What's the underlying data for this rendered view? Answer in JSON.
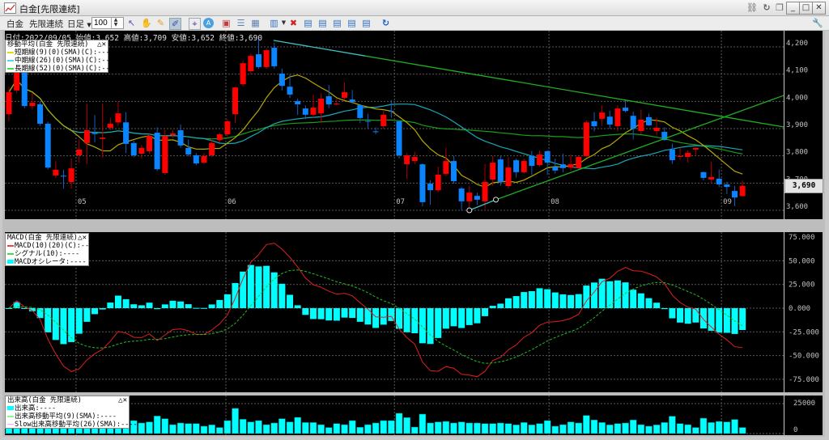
{
  "window": {
    "title": "白金[先限連続]",
    "controls": [
      "link-icon",
      "refresh-icon",
      "copy-icon",
      "minimize-icon",
      "maximize-icon",
      "close-icon"
    ]
  },
  "toolbar": {
    "symbol": "白金",
    "contract": "先限連続",
    "period": "日足",
    "count": "100",
    "tools": [
      "cursor-icon",
      "hand-icon",
      "pencil-icon",
      "trendline-icon",
      "crosshair-icon",
      "auto-icon",
      "chart-settings-icon",
      "grid-h-icon",
      "grid-icon",
      "bar-chart-icon",
      "delete-icon",
      "layout1-icon",
      "layout2-icon",
      "layout3-icon",
      "layout4-icon",
      "layout5-icon",
      "reload-icon"
    ],
    "settings_icon": "wrench-icon"
  },
  "info": "日付:2022/09/05 始値:3,652 高値:3,709 安値:3,652 終値:3,690",
  "main_legend": {
    "title": "移動平均(白金 先限連続)",
    "items": [
      {
        "label": "短期線(9)(0)(SMA)(C):----",
        "color": "#e0e000"
      },
      {
        "label": "中期線(26)(0)(SMA)(C):----",
        "color": "#40e0f0"
      },
      {
        "label": "長期線(52)(0)(SMA)(C):----",
        "color": "#40e040"
      }
    ]
  },
  "macd_legend": {
    "title": "MACD(白金 先限連続)",
    "items": [
      {
        "label": "MACD(10)(20)(C):----",
        "color": "#ff4040"
      },
      {
        "label": "シグナル(10):----",
        "color": "#40e040"
      },
      {
        "label": "MACDオシレータ:----",
        "color": "#00ffff"
      }
    ]
  },
  "volume_legend": {
    "title": "出来高(白金 先限連続)",
    "items": [
      {
        "label": "出来高:----",
        "color": "#00ffff"
      },
      {
        "label": "出来高移動平均(9)(SMA):----",
        "color": "#80ff80"
      },
      {
        "label": "Slow出来高移動平均(26)(SMA):----",
        "color": "#ffa0ff"
      }
    ]
  },
  "current_price": "3,690",
  "colors": {
    "up": "#ff0000",
    "down": "#0a84ff",
    "sma_short": "#b8a800",
    "sma_mid": "#1aa8b8",
    "sma_long": "#18a018",
    "macd": "#e02020",
    "signal": "#20c020",
    "histogram": "#00ffff",
    "volume": "#00ffff"
  },
  "chart_data": [
    {
      "type": "candlestick",
      "price_axis": {
        "ticks": [
          "4,200",
          "4,100",
          "4,000",
          "3,900",
          "3,800",
          "3,700",
          "3,600"
        ],
        "range": [
          3600,
          4200
        ]
      },
      "month_labels": [
        {
          "label": "05",
          "index": 8.6
        },
        {
          "label": "06",
          "index": 27.8
        },
        {
          "label": "07",
          "index": 49.4
        },
        {
          "label": "08",
          "index": 69.2
        },
        {
          "label": "09",
          "index": 91.3
        }
      ],
      "ohlc": [
        [
          3953,
          4053,
          3927,
          4034
        ],
        [
          4040,
          4140,
          4030,
          4125
        ],
        [
          4120,
          4130,
          3975,
          3983
        ],
        [
          3983,
          4030,
          3970,
          3995
        ],
        [
          3989,
          4000,
          3910,
          3918
        ],
        [
          3918,
          3925,
          3750,
          3757
        ],
        [
          3728,
          3781,
          3719,
          3749
        ],
        [
          3727,
          3749,
          3680,
          3724
        ],
        [
          3704,
          3790,
          3680,
          3754
        ],
        [
          3802,
          3860,
          3775,
          3823
        ],
        [
          3847,
          3990,
          3770,
          3894
        ],
        [
          3884,
          3950,
          3850,
          3880
        ],
        [
          3862,
          3992,
          3793,
          3867
        ],
        [
          3903,
          3940,
          3895,
          3918
        ],
        [
          3923,
          4000,
          3910,
          3956
        ],
        [
          3923,
          3960,
          3810,
          3844
        ],
        [
          3847,
          3855,
          3795,
          3802
        ],
        [
          3808,
          3840,
          3790,
          3829
        ],
        [
          3817,
          3880,
          3808,
          3873
        ],
        [
          3885,
          3905,
          3745,
          3751
        ],
        [
          3737,
          3895,
          3730,
          3873
        ],
        [
          3876,
          3895,
          3865,
          3882
        ],
        [
          3894,
          3915,
          3830,
          3838
        ],
        [
          3829,
          3860,
          3798,
          3805
        ],
        [
          3802,
          3810,
          3765,
          3772
        ],
        [
          3775,
          3810,
          3770,
          3799
        ],
        [
          3802,
          3865,
          3795,
          3847
        ],
        [
          3858,
          3885,
          3850,
          3879
        ],
        [
          3879,
          3935,
          3870,
          3927
        ],
        [
          3953,
          4055,
          3920,
          4051
        ],
        [
          4063,
          4150,
          4055,
          4140
        ],
        [
          4111,
          4175,
          4100,
          4167
        ],
        [
          4173,
          4232,
          4120,
          4126
        ],
        [
          4126,
          4195,
          4120,
          4188
        ],
        [
          4197,
          4215,
          4120,
          4129
        ],
        [
          4102,
          4120,
          4040,
          4057
        ],
        [
          4054,
          4100,
          4012,
          4025
        ],
        [
          4001,
          4010,
          3950,
          3989
        ],
        [
          3974,
          3985,
          3935,
          3951
        ],
        [
          3951,
          4025,
          3940,
          3977
        ],
        [
          3956,
          4030,
          3920,
          4010
        ],
        [
          4019,
          4060,
          3975,
          3989
        ],
        [
          3989,
          4010,
          3985,
          3992
        ],
        [
          4013,
          4070,
          4005,
          4034
        ],
        [
          4007,
          4042,
          3990,
          3998
        ],
        [
          3986,
          3990,
          3920,
          3939
        ],
        [
          3928,
          3955,
          3900,
          3925
        ],
        [
          3890,
          3905,
          3880,
          3887
        ],
        [
          3909,
          3965,
          3900,
          3951
        ],
        [
          3965,
          4005,
          3940,
          3962
        ],
        [
          3927,
          3930,
          3790,
          3802
        ],
        [
          3769,
          3810,
          3715,
          3802
        ],
        [
          3781,
          3815,
          3770,
          3796
        ],
        [
          3769,
          3772,
          3615,
          3630
        ],
        [
          3698,
          3710,
          3620,
          3674
        ],
        [
          3674,
          3760,
          3665,
          3731
        ],
        [
          3734,
          3830,
          3725,
          3781
        ],
        [
          3781,
          3800,
          3698,
          3707
        ],
        [
          3680,
          3685,
          3600,
          3633
        ],
        [
          3633,
          3690,
          3610,
          3665
        ],
        [
          3653,
          3665,
          3620,
          3639
        ],
        [
          3633,
          3770,
          3605,
          3704
        ],
        [
          3713,
          3800,
          3690,
          3775
        ],
        [
          3787,
          3800,
          3690,
          3704
        ],
        [
          3689,
          3795,
          3680,
          3757
        ],
        [
          3784,
          3790,
          3720,
          3740
        ],
        [
          3740,
          3790,
          3735,
          3781
        ],
        [
          3799,
          3818,
          3730,
          3763
        ],
        [
          3766,
          3820,
          3760,
          3805
        ],
        [
          3817,
          3820,
          3730,
          3775
        ],
        [
          3760,
          3790,
          3735,
          3746
        ],
        [
          3769,
          3808,
          3740,
          3755
        ],
        [
          3757,
          3805,
          3745,
          3769
        ],
        [
          3755,
          3800,
          3750,
          3796
        ],
        [
          3799,
          3930,
          3795,
          3923
        ],
        [
          3927,
          3960,
          3890,
          3909
        ],
        [
          3936,
          3985,
          3910,
          3959
        ],
        [
          3944,
          3965,
          3900,
          3915
        ],
        [
          3909,
          3985,
          3890,
          3974
        ],
        [
          3977,
          4005,
          3960,
          3965
        ],
        [
          3947,
          3962,
          3860,
          3900
        ],
        [
          3891,
          3970,
          3880,
          3933
        ],
        [
          3942,
          3955,
          3910,
          3912
        ],
        [
          3891,
          3940,
          3875,
          3903
        ],
        [
          3888,
          3905,
          3855,
          3858
        ],
        [
          3823,
          3845,
          3770,
          3784
        ],
        [
          3797,
          3830,
          3785,
          3799
        ],
        [
          3796,
          3820,
          3775,
          3811
        ],
        [
          3823,
          3830,
          3800,
          3829
        ],
        [
          3740,
          3742,
          3710,
          3719
        ],
        [
          3713,
          3780,
          3700,
          3722
        ],
        [
          3716,
          3750,
          3685,
          3695
        ],
        [
          3695,
          3705,
          3660,
          3686
        ],
        [
          3671,
          3690,
          3615,
          3647
        ],
        [
          3652,
          3709,
          3652,
          3690
        ]
      ],
      "moving_averages": [
        9,
        26,
        52
      ],
      "trendlines": [
        {
          "points": [
            [
              33.9,
              4224
            ],
            [
              99.3,
              3906
            ]
          ],
          "colors": [
            "#40c0c0",
            "#20b020"
          ]
        },
        {
          "points": [
            [
              59.0,
              3600
            ],
            [
              62.4,
              3639
            ],
            [
              99.3,
              4022
            ]
          ],
          "colors": [
            "#40c0c0",
            "#20b020"
          ],
          "markers": true
        }
      ]
    },
    {
      "type": "macd",
      "fast": 10,
      "slow": 20,
      "signal": 10,
      "axis": {
        "ticks": [
          "75.000",
          "50.000",
          "25.000",
          "0.000",
          "-25.000",
          "-50.000",
          "-75.000"
        ],
        "range": [
          -85,
          80
        ]
      }
    },
    {
      "type": "bar",
      "axis": {
        "ticks": [
          "25000",
          "0"
        ],
        "range": [
          0,
          25000
        ]
      },
      "volume": [
        7000,
        7200,
        8000,
        7000,
        7500,
        8000,
        7200,
        6800,
        7000,
        7600,
        7000,
        7200,
        6600,
        7200,
        7000,
        19000,
        10800,
        8800,
        9700,
        14600,
        12400,
        7400,
        8800,
        8300,
        8300,
        6100,
        7200,
        5000,
        10800,
        21000,
        11900,
        9700,
        10800,
        7400,
        8800,
        12400,
        9700,
        13500,
        9200,
        9200,
        7400,
        5000,
        8300,
        7400,
        10800,
        5200,
        7400,
        8800,
        10800,
        10800,
        16900,
        13300,
        5400,
        16200,
        8800,
        9700,
        10100,
        8800,
        9700,
        8800,
        8800,
        8300,
        8300,
        8800,
        8300,
        7200,
        9200,
        7200,
        8300,
        10800,
        6100,
        7400,
        9700,
        8800,
        15100,
        11300,
        9200,
        7200,
        8300,
        8800,
        11300,
        7400,
        6100,
        7200,
        9200,
        14400,
        8300,
        7400,
        5000,
        12800,
        9200,
        10100,
        9700,
        11700,
        5000
      ]
    }
  ]
}
